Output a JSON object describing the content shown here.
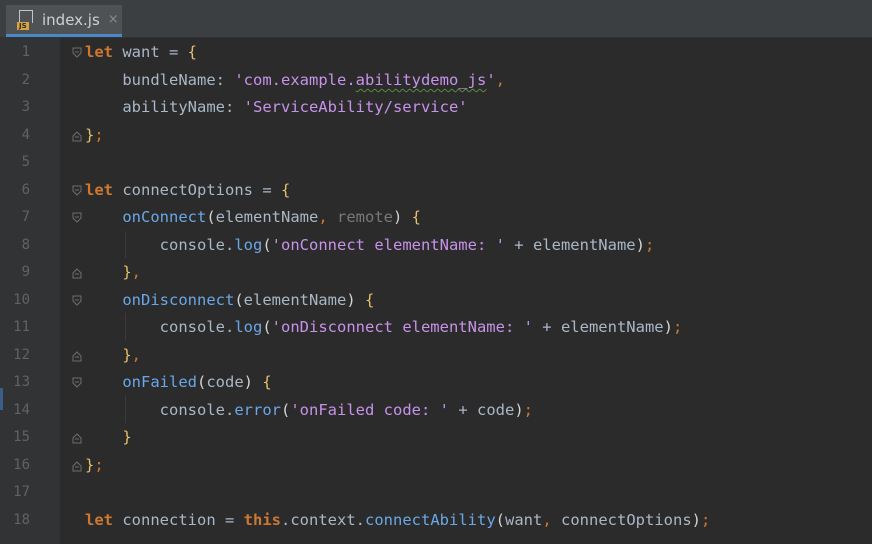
{
  "tab": {
    "label": "index.js",
    "badge": "JS",
    "close": "×"
  },
  "lines": [
    {
      "n": "1",
      "fold": "open"
    },
    {
      "n": "2"
    },
    {
      "n": "3"
    },
    {
      "n": "4",
      "fold": "close"
    },
    {
      "n": "5"
    },
    {
      "n": "6",
      "fold": "open"
    },
    {
      "n": "7",
      "fold": "open"
    },
    {
      "n": "8"
    },
    {
      "n": "9",
      "fold": "close"
    },
    {
      "n": "10",
      "fold": "open"
    },
    {
      "n": "11"
    },
    {
      "n": "12",
      "fold": "close"
    },
    {
      "n": "13",
      "fold": "open"
    },
    {
      "n": "14"
    },
    {
      "n": "15",
      "fold": "close"
    },
    {
      "n": "16",
      "fold": "close"
    },
    {
      "n": "17"
    },
    {
      "n": "18"
    }
  ],
  "code": {
    "l1": {
      "kw": "let",
      "name": " want ",
      "op": "=",
      "brace": " {"
    },
    "l2": {
      "key": "    bundleName",
      "colon": ": ",
      "q1": "'",
      "val_a": "com.example.",
      "val_b": "abilitydemo_js",
      "q2": "'",
      "comma": ","
    },
    "l3": {
      "key": "    abilityName",
      "colon": ": ",
      "val": "'ServiceAbility/service'"
    },
    "l4": {
      "brace": "}",
      "semi": ";"
    },
    "l6": {
      "kw": "let",
      "name": " connectOptions ",
      "op": "=",
      "brace": " {"
    },
    "l7": {
      "indent": "    ",
      "fn": "onConnect",
      "p1": "(",
      "a1": "elementName",
      "comma": ", ",
      "a2": "remote",
      "p2": ")",
      "brace": " {"
    },
    "l8": {
      "indent": "        ",
      "obj": "console",
      "dot": ".",
      "meth": "log",
      "p1": "(",
      "str": "'onConnect elementName: '",
      "plus": " + ",
      "arg": "elementName",
      "p2": ")",
      "semi": ";"
    },
    "l9": {
      "indent": "    ",
      "brace": "}",
      "comma": ","
    },
    "l10": {
      "indent": "    ",
      "fn": "onDisconnect",
      "p1": "(",
      "a1": "elementName",
      "p2": ")",
      "brace": " {"
    },
    "l11": {
      "indent": "        ",
      "obj": "console",
      "dot": ".",
      "meth": "log",
      "p1": "(",
      "str": "'onDisconnect elementName: '",
      "plus": " + ",
      "arg": "elementName",
      "p2": ")",
      "semi": ";"
    },
    "l12": {
      "indent": "    ",
      "brace": "}",
      "comma": ","
    },
    "l13": {
      "indent": "    ",
      "fn": "onFailed",
      "p1": "(",
      "a1": "code",
      "p2": ")",
      "brace": " {"
    },
    "l14": {
      "indent": "        ",
      "obj": "console",
      "dot": ".",
      "meth": "error",
      "p1": "(",
      "str": "'onFailed code: '",
      "plus": " + ",
      "arg": "code",
      "p2": ")",
      "semi": ";"
    },
    "l15": {
      "indent": "    ",
      "brace": "}"
    },
    "l16": {
      "brace": "}",
      "semi": ";"
    },
    "l18": {
      "kw": "let",
      "name": " connection ",
      "op": "= ",
      "this": "this",
      "dot1": ".",
      "ctx": "context",
      "dot2": ".",
      "meth": "connectAbility",
      "p1": "(",
      "a1": "want",
      "comma": ", ",
      "a2": "connectOptions",
      "p2": ")",
      "semi": ";"
    }
  },
  "colors": {
    "keyword": "#cc7832",
    "string": "#c792ea",
    "function": "#6aa7e8",
    "background": "#2b2b2b"
  }
}
